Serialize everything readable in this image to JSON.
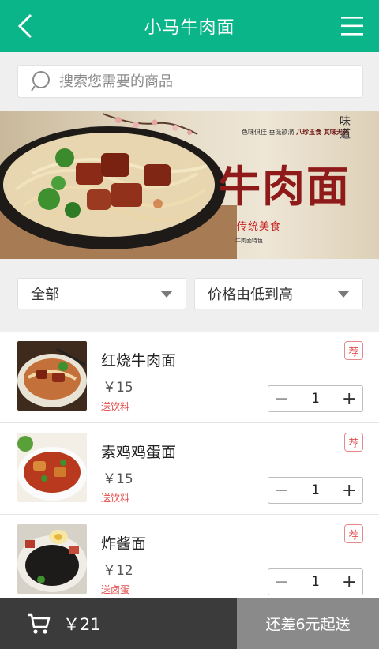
{
  "header": {
    "title": "小马牛肉面",
    "back_icon": "chevron-left-icon",
    "menu_icon": "hamburger-menu-icon"
  },
  "search": {
    "placeholder": "搜索您需要的商品",
    "icon": "search-icon"
  },
  "banner": {
    "title": "牛肉面",
    "slogan_plain": "色味俱佳 垂涎欲滴",
    "slogan_bold": "八珍玉食 其味无穷",
    "badge": "传统美食",
    "weidao": "味道",
    "caption": "牛肉面特色"
  },
  "filters": {
    "category": "全部",
    "sort": "价格由低到高"
  },
  "products": [
    {
      "name": "红烧牛肉面",
      "price": "￥15",
      "gift": "送饮料",
      "tag": "荐",
      "qty": "1"
    },
    {
      "name": "素鸡鸡蛋面",
      "price": "￥15",
      "gift": "送饮料",
      "tag": "荐",
      "qty": "1"
    },
    {
      "name": "炸酱面",
      "price": "￥12",
      "gift": "送卤蛋",
      "tag": "荐",
      "qty": "1"
    }
  ],
  "stepper": {
    "minus": "−",
    "plus": "+"
  },
  "cart": {
    "icon": "cart-icon",
    "total": "￥21",
    "checkout_label": "还差6元起送"
  },
  "colors": {
    "header": "#0bb58a",
    "accent_red": "#e14b4b",
    "cart_bar": "#3b3b3b",
    "checkout_disabled": "#8a8a8a"
  }
}
